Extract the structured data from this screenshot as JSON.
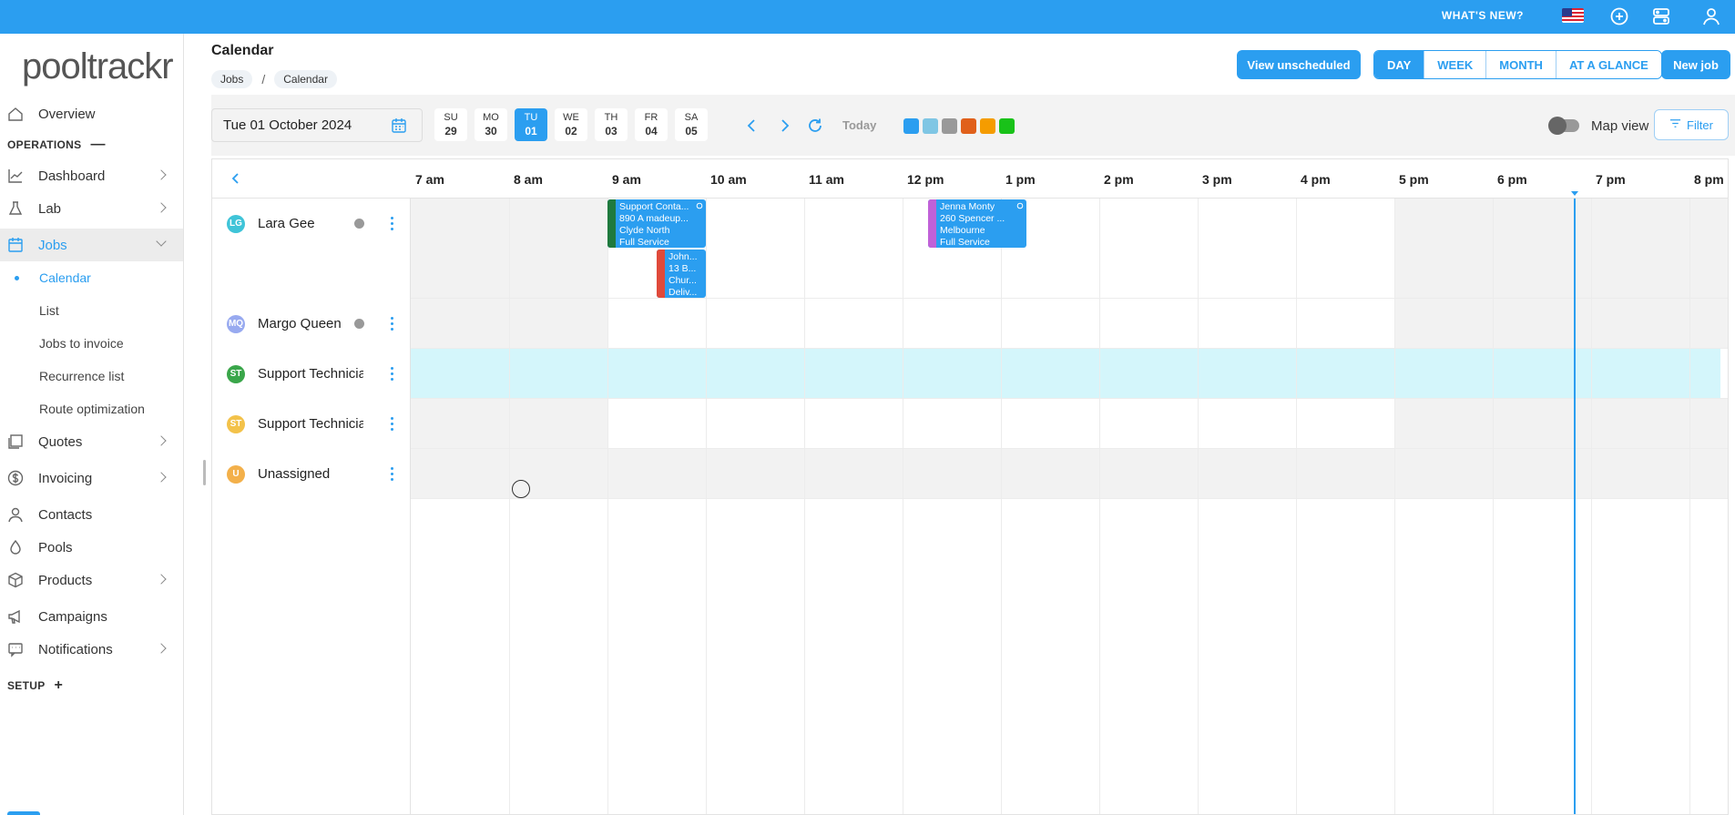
{
  "topbar": {
    "whats_new": "WHAT'S NEW?",
    "icons": [
      "flag-us-icon",
      "add-circle-icon",
      "settings-panel-icon",
      "user-icon"
    ]
  },
  "brand": {
    "logo_text": "pooltrackr",
    "accent": "#2b9ef0"
  },
  "sidebar": {
    "overview": "Overview",
    "operations_label": "OPERATIONS",
    "operations_symbol": "—",
    "items": {
      "dashboard": "Dashboard",
      "lab": "Lab",
      "jobs": "Jobs",
      "calendar": "Calendar",
      "list": "List",
      "jobs_to_invoice": "Jobs to invoice",
      "recurrence_list": "Recurrence list",
      "route_optimization": "Route optimization",
      "quotes": "Quotes",
      "invoicing": "Invoicing",
      "contacts": "Contacts",
      "pools": "Pools",
      "products": "Products",
      "campaigns": "Campaigns",
      "notifications": "Notifications"
    },
    "setup_label": "SETUP",
    "setup_symbol": "+"
  },
  "header": {
    "title": "Calendar",
    "breadcrumb": [
      "Jobs",
      "Calendar"
    ],
    "breadcrumb_sep": "/",
    "view_unscheduled": "View unscheduled",
    "views": [
      "DAY",
      "WEEK",
      "MONTH",
      "AT A GLANCE"
    ],
    "active_view": "DAY",
    "new_job": "New job"
  },
  "toolbar": {
    "date": "Tue 01 October 2024",
    "days": [
      {
        "dow": "SU",
        "num": "29"
      },
      {
        "dow": "MO",
        "num": "30"
      },
      {
        "dow": "TU",
        "num": "01"
      },
      {
        "dow": "WE",
        "num": "02"
      },
      {
        "dow": "TH",
        "num": "03"
      },
      {
        "dow": "FR",
        "num": "04"
      },
      {
        "dow": "SA",
        "num": "05"
      }
    ],
    "active_day": "TU",
    "today": "Today",
    "swatches": [
      "#2b9ef0",
      "#7fc6e4",
      "#999999",
      "#e0601b",
      "#f59c00",
      "#19c219"
    ],
    "map_view": "Map view",
    "map_view_on": false,
    "filter": "Filter"
  },
  "calendar": {
    "hours": [
      "7 am",
      "8 am",
      "9 am",
      "10 am",
      "11 am",
      "12 pm",
      "1 pm",
      "2 pm",
      "3 pm",
      "4 pm",
      "5 pm",
      "6 pm",
      "7 pm",
      "8 pm"
    ],
    "people": [
      {
        "initials": "LG",
        "name": "Lara Gee",
        "color": "#3fc4d8",
        "status": true
      },
      {
        "initials": "MQ",
        "name": "Margo Queen",
        "color": "#98aaf0",
        "status": true
      },
      {
        "initials": "ST",
        "name": "Support Technician",
        "color": "#3aa64a",
        "status": false
      },
      {
        "initials": "ST",
        "name": "Support Technician",
        "color": "#f3c24a",
        "status": false
      },
      {
        "initials": "U",
        "name": "Unassigned",
        "color": "#f3b04a",
        "status": false
      }
    ],
    "jobs": [
      {
        "lines": [
          "Support Conta...",
          "890 A madeup...",
          "Clyde North",
          "Full Service"
        ],
        "bar": "#1f7a3e"
      },
      {
        "lines": [
          "John...",
          "13 B...",
          "Chur...",
          "Deliv..."
        ],
        "bar": "#e04a3a"
      },
      {
        "lines": [
          "Jenna Monty",
          "260 Spencer ...",
          "Melbourne",
          "Full Service"
        ],
        "bar": "#c061d8"
      }
    ]
  }
}
